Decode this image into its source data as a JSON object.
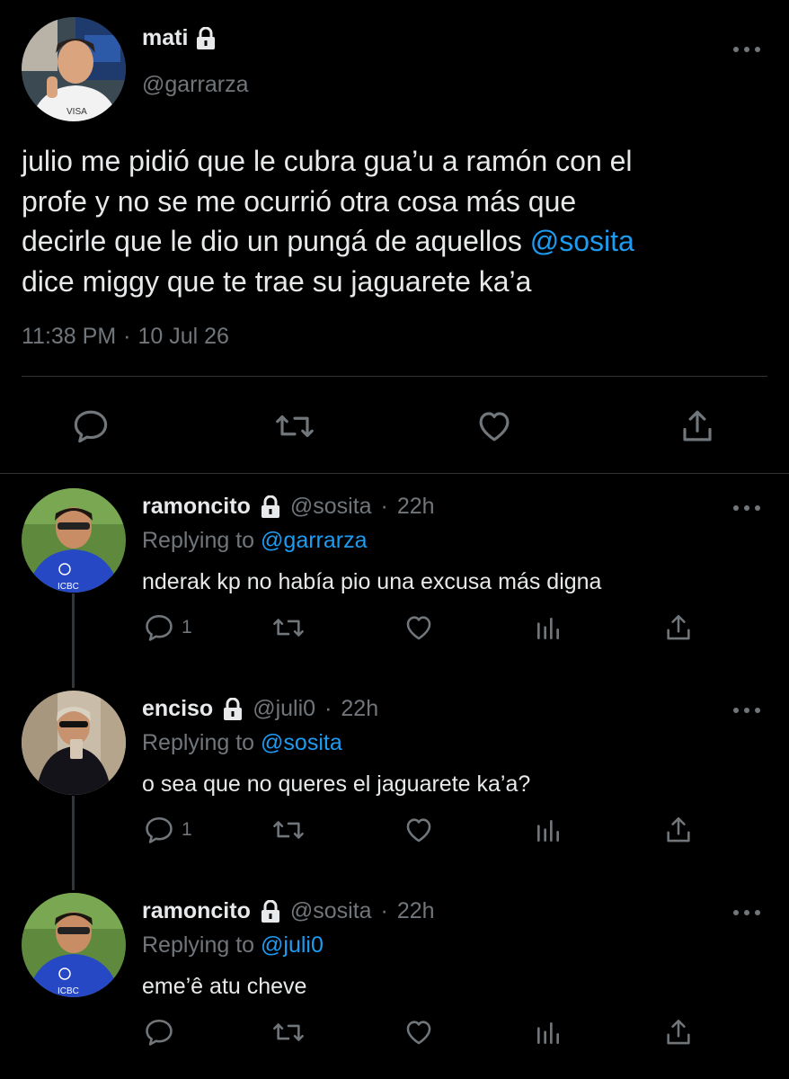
{
  "tweet": {
    "name": "mati",
    "handle": "@garrarza",
    "text_lines": [
      "julio me pidió que le cubra gua’u a ramón con el",
      "profe y no se me ocurrió otra cosa más que",
      "decirle que le dio un pungá de aquellos ",
      "dice miggy que te trae su jaguarete ka’a"
    ],
    "mention": "@sosita",
    "time": "11:38 PM",
    "separator": "·",
    "date": "10 Jul 26",
    "icons": [
      "reply-icon",
      "retweet-icon",
      "like-icon",
      "share-icon"
    ]
  },
  "replies": [
    {
      "name": "ramoncito",
      "handle": "@sosita",
      "time": "22h",
      "replying_prefix": "Replying to",
      "replying_to": "@garrarza",
      "text": "nderak kp no había pio una excusa más digna",
      "reply_count": "1"
    },
    {
      "name": "enciso",
      "handle": "@juli0",
      "time": "22h",
      "replying_prefix": "Replying to",
      "replying_to": "@sosita",
      "text": "o sea que no queres el jaguarete ka’a?",
      "reply_count": "1"
    },
    {
      "name": "ramoncito",
      "handle": "@sosita",
      "time": "22h",
      "replying_prefix": "Replying to",
      "replying_to": "@juli0",
      "text": "eme’ê atu cheve",
      "reply_count": ""
    }
  ],
  "colors": {
    "background": "#000000",
    "text": "#e7e9ea",
    "muted": "#71767b",
    "link": "#1d9bf0",
    "divider": "#2f3336"
  }
}
